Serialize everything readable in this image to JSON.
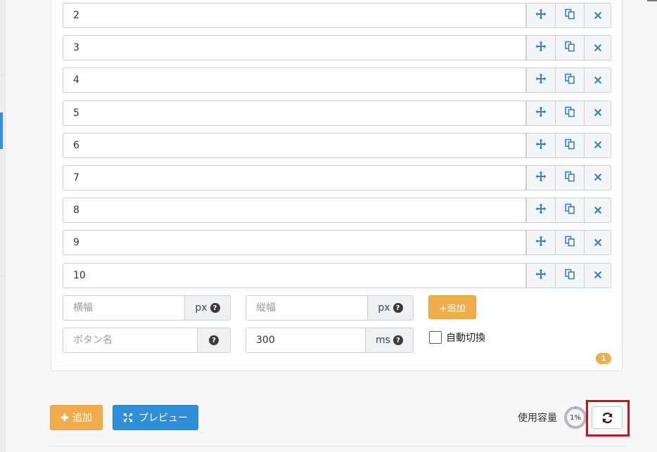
{
  "slides": {
    "items": [
      {
        "value": "2"
      },
      {
        "value": "3"
      },
      {
        "value": "4"
      },
      {
        "value": "5"
      },
      {
        "value": "6"
      },
      {
        "value": "7"
      },
      {
        "value": "8"
      },
      {
        "value": "9"
      },
      {
        "value": "10"
      }
    ]
  },
  "icons": {
    "move": "arrows-move-icon",
    "copy": "copy-icon",
    "delete": "close-icon",
    "refresh": "refresh-icon",
    "preview": "expand-icon",
    "plus": "plus-icon",
    "help": "question-icon"
  },
  "settings": {
    "width_placeholder": "横幅",
    "width_unit": "px",
    "height_placeholder": "縦幅",
    "height_unit": "px",
    "add_small_label": "+追加",
    "button_name_placeholder": "ボタン名",
    "help_mark": "?",
    "interval_value": "300",
    "interval_unit": "ms",
    "auto_switch_label": "自動切換",
    "auto_switch_checked": false,
    "badge_count": "1"
  },
  "footer": {
    "add_label": "追加",
    "preview_label": "プレビュー",
    "usage_label": "使用容量",
    "usage_percent": "1%",
    "usage_fraction": 0.01
  },
  "colors": {
    "orange": "#f0ad4e",
    "blue": "#2f8fd8",
    "icon_blue": "#3a7fc4",
    "highlight": "#d0101a"
  }
}
